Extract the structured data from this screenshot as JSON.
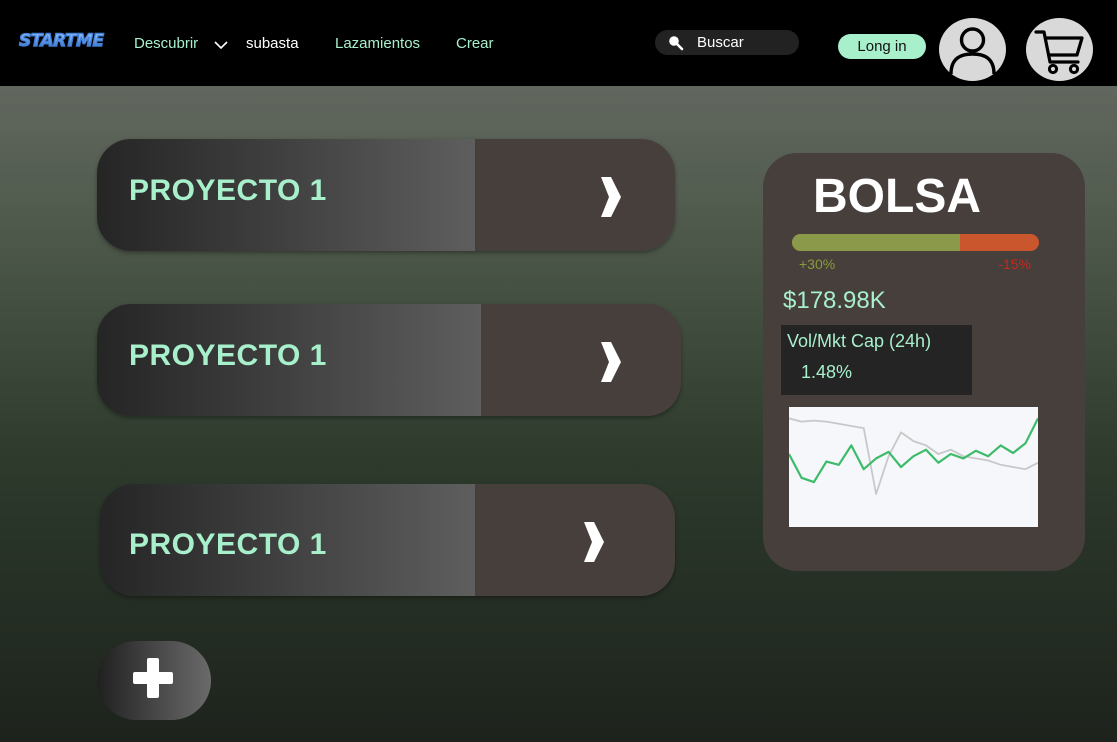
{
  "brand": {
    "logo_text": "STARTME",
    "logo_color": "#3f7fd8"
  },
  "nav": {
    "items": [
      {
        "label": "Descubrir"
      },
      {
        "label": "subasta"
      },
      {
        "label": "Lazamientos"
      },
      {
        "label": "Crear"
      }
    ],
    "chevron_icon": "chevron-down-icon"
  },
  "search": {
    "placeholder": "Buscar",
    "icon": "search-icon"
  },
  "header": {
    "login_label": "Long in",
    "user_icon": "user-icon",
    "cart_icon": "cart-icon"
  },
  "projects": [
    {
      "title": "PROYECTO 1",
      "arrow_icon": "chevron-right-icon"
    },
    {
      "title": "PROYECTO 1",
      "arrow_icon": "chevron-right-icon"
    },
    {
      "title": "PROYECTO 1",
      "arrow_icon": "chevron-right-icon"
    }
  ],
  "add_button": {
    "icon": "plus-icon"
  },
  "bolsa": {
    "title": "BOLSA",
    "up_ratio": 0.68,
    "up_label": "+30%",
    "down_label": "-15%",
    "price": "$178.98K",
    "vol_label": "Vol/Mkt Cap (24h)",
    "vol_value": "1.48%"
  },
  "colors": {
    "accent": "#a8f0cc",
    "card_dark": "#473f3c",
    "bar_up": "#8a9a4a",
    "bar_down": "#c9562c",
    "line_main": "#3dbb6a",
    "line_ref": "#c8c8c8"
  },
  "chart_data": {
    "type": "line",
    "series": [
      {
        "values": [
          62,
          40,
          36,
          55,
          52,
          70,
          48,
          58,
          64,
          50,
          60,
          66,
          54,
          62,
          58,
          65,
          60,
          70,
          63,
          72,
          95
        ]
      },
      {
        "values": [
          95,
          92,
          93,
          92,
          90,
          88,
          86,
          25,
          60,
          82,
          74,
          70,
          62,
          66,
          60,
          58,
          56,
          52,
          50,
          48,
          54
        ]
      }
    ],
    "ylim": [
      0,
      100
    ]
  }
}
